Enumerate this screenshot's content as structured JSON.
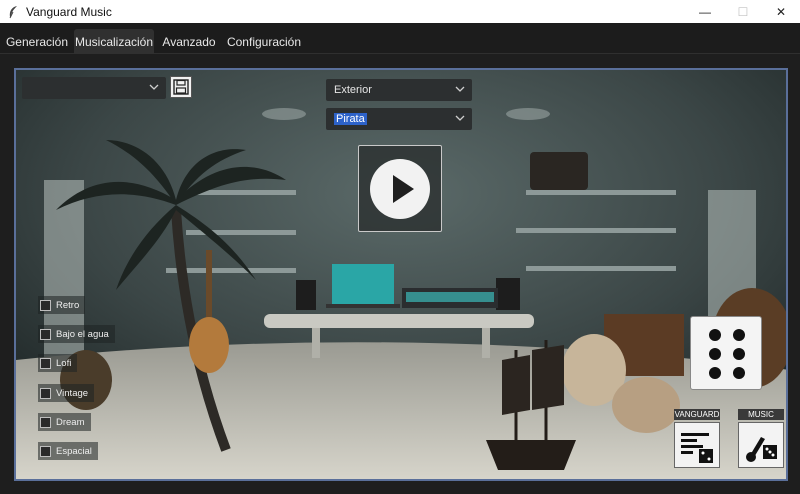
{
  "window": {
    "title": "Vanguard Music",
    "minimize": "—",
    "maximize": "☐",
    "close": "✕"
  },
  "tabs": [
    {
      "label": "Generación",
      "active": false
    },
    {
      "label": "Musicalización",
      "active": true
    },
    {
      "label": "Avanzado",
      "active": false
    },
    {
      "label": "Configuración",
      "active": false
    }
  ],
  "controls": {
    "preset_combo_value": "",
    "location_combo_value": "Exterior",
    "style_combo_value": "Pirata"
  },
  "effects": [
    {
      "label": "Retro",
      "checked": false
    },
    {
      "label": "Bajo el agua",
      "checked": false
    },
    {
      "label": "Lofi",
      "checked": false
    },
    {
      "label": "Vintage",
      "checked": false
    },
    {
      "label": "Dream",
      "checked": false
    },
    {
      "label": "Espacial",
      "checked": false
    }
  ],
  "logos": {
    "vanguard_label": "VANGUARD",
    "music_label": "MUSIC"
  },
  "icons": {
    "app": "feather-icon",
    "save": "floppy-disk-icon",
    "play": "play-icon",
    "dice": "dice-six-icon",
    "chevron": "chevron-down-icon"
  },
  "colors": {
    "selection": "#2d62c9",
    "frame_border": "#5a6f9a",
    "tab_active": "#303030"
  }
}
